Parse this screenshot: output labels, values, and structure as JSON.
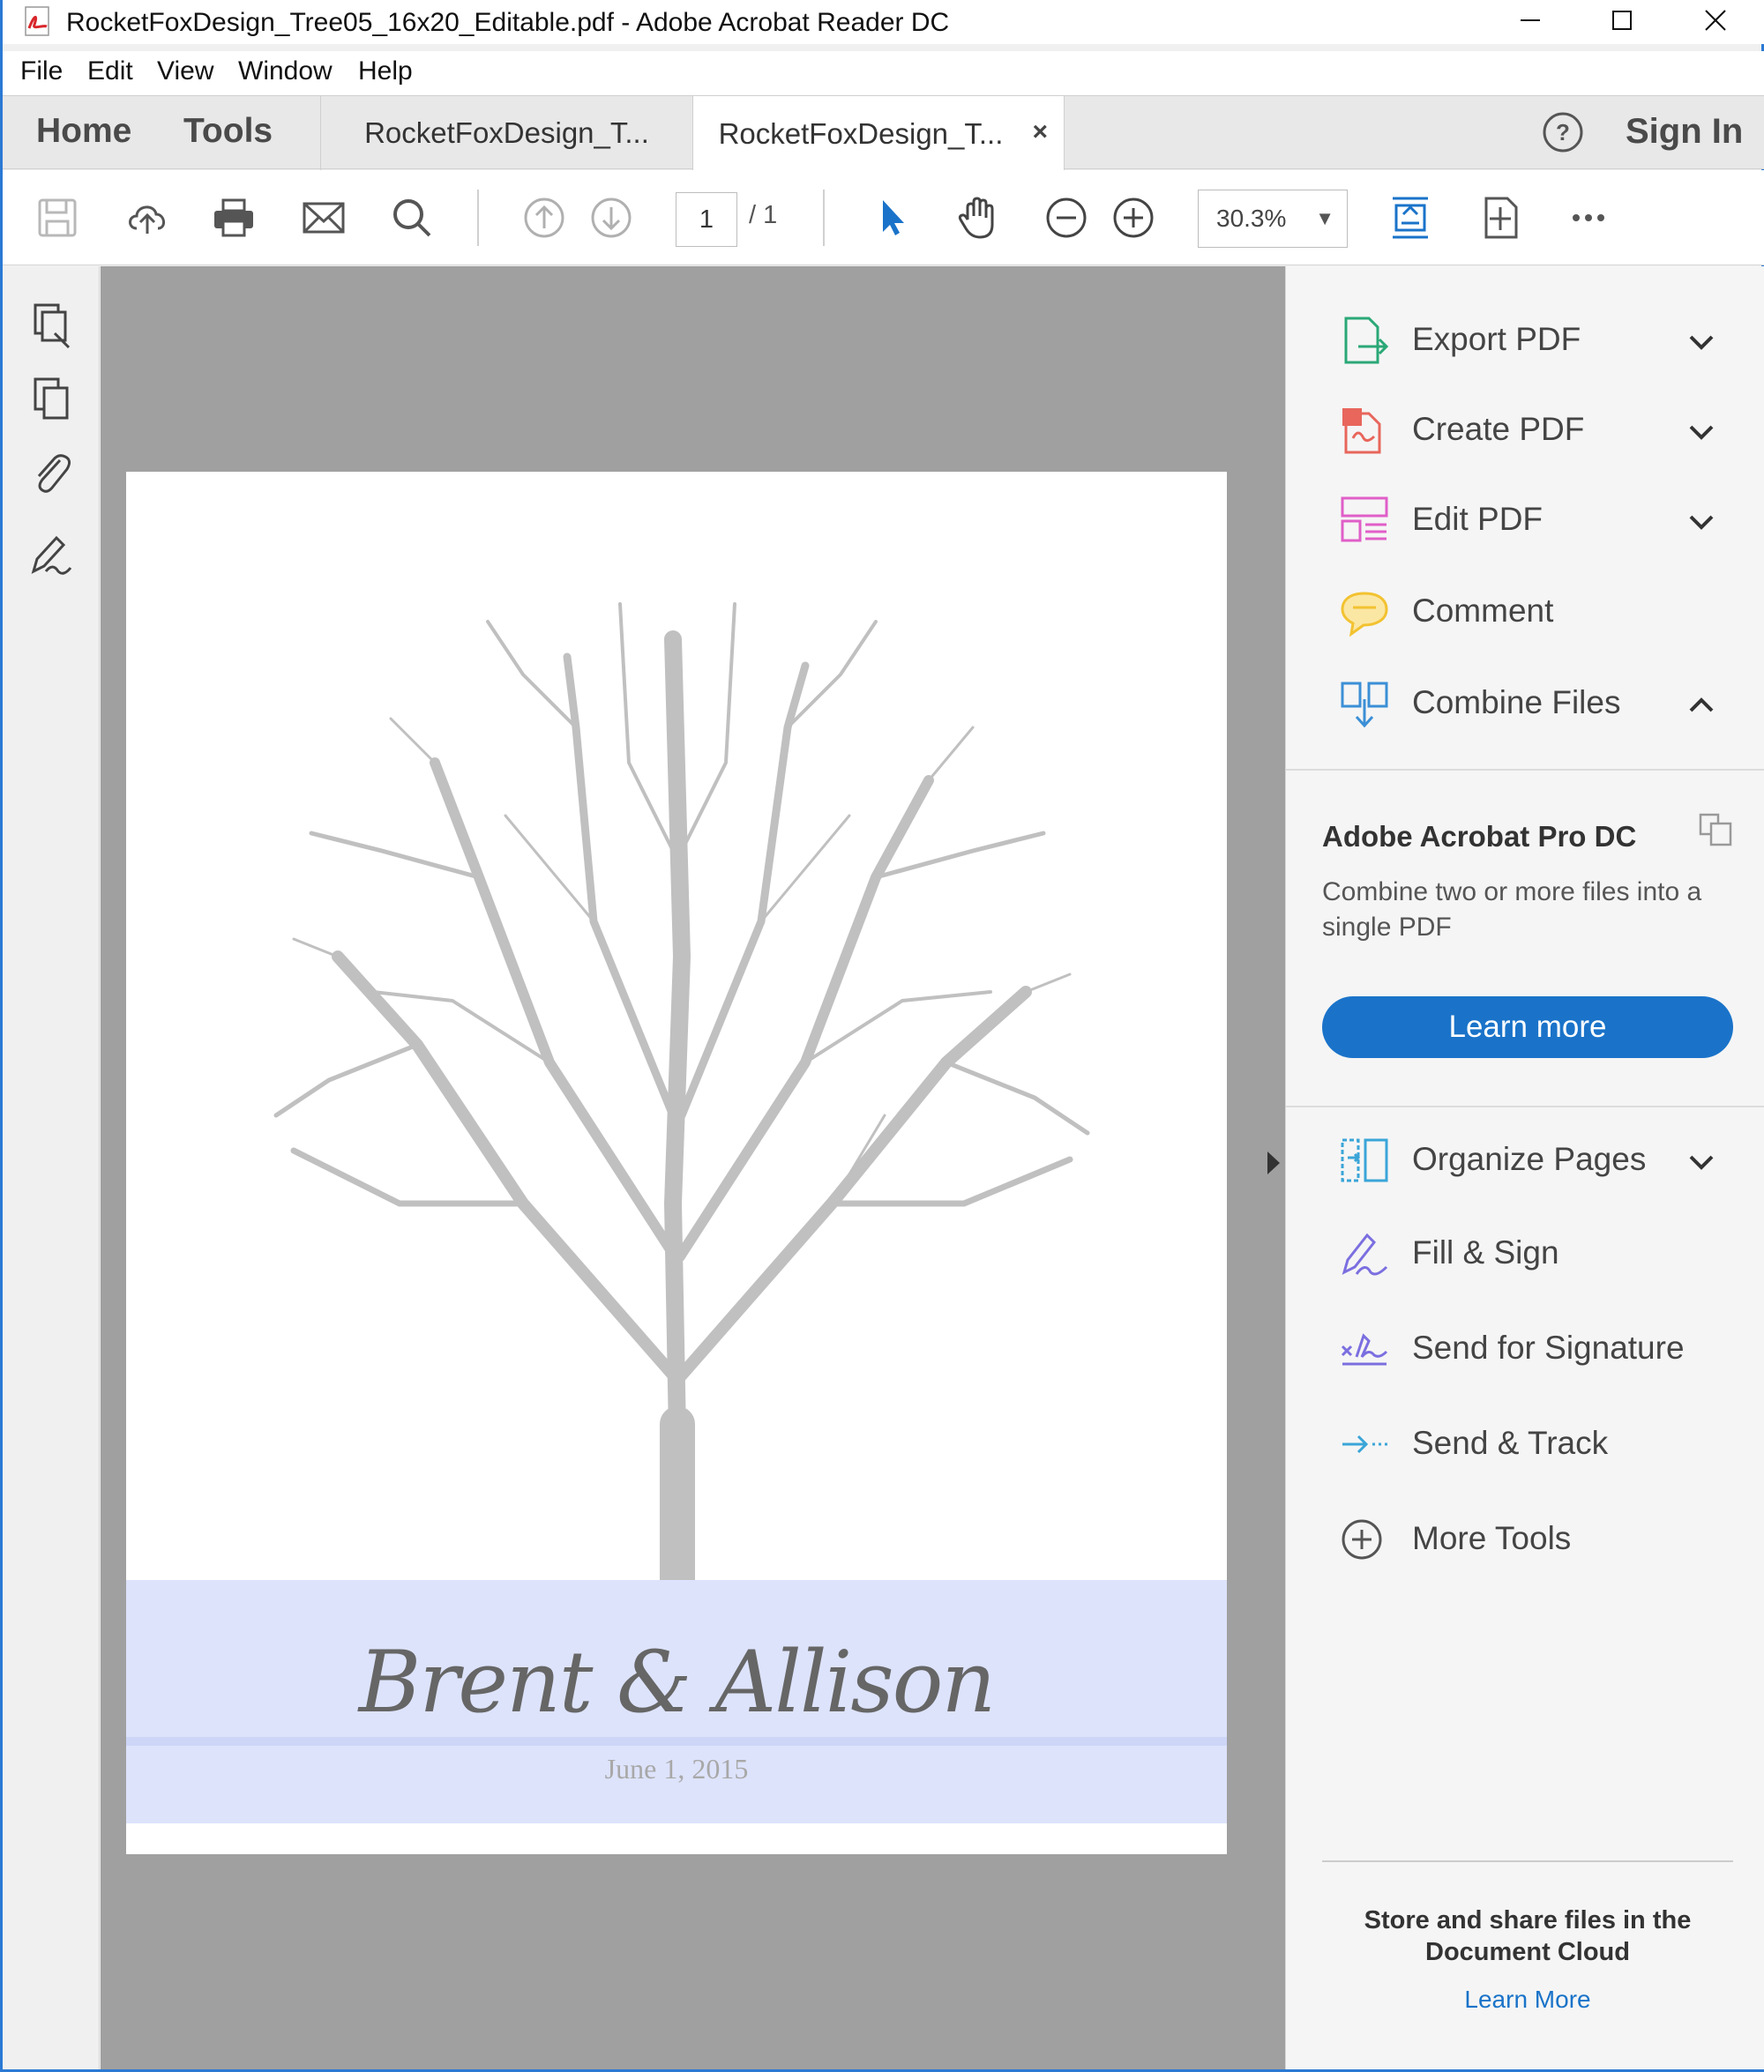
{
  "window": {
    "title": "RocketFoxDesign_Tree05_16x20_Editable.pdf - Adobe Acrobat Reader DC"
  },
  "menu": {
    "items": [
      {
        "label": "File"
      },
      {
        "label": "Edit"
      },
      {
        "label": "View"
      },
      {
        "label": "Window"
      },
      {
        "label": "Help"
      }
    ]
  },
  "tabs": {
    "home": "Home",
    "tools": "Tools",
    "documents": [
      {
        "label": "RocketFoxDesign_T..."
      },
      {
        "label": "RocketFoxDesign_T...",
        "close": "×"
      }
    ],
    "sign_in": "Sign In"
  },
  "toolbar": {
    "page_current": "1",
    "page_total": "/ 1",
    "zoom": "30.3%"
  },
  "document": {
    "names": "Brent & Allison",
    "date": "June 1, 2015"
  },
  "right_pane": {
    "tools_top": [
      {
        "label": "Export PDF",
        "icon": "export-pdf-icon",
        "color": "#2aa876"
      },
      {
        "label": "Create PDF",
        "icon": "create-pdf-icon",
        "color": "#e8665c"
      },
      {
        "label": "Edit PDF",
        "icon": "edit-pdf-icon",
        "color": "#e05ec8"
      },
      {
        "label": "Comment",
        "icon": "comment-icon",
        "color": "#f2c230"
      },
      {
        "label": "Combine Files",
        "icon": "combine-files-icon",
        "color": "#3b8fd6"
      }
    ],
    "promo": {
      "title": "Adobe Acrobat Pro DC",
      "text": "Combine two or more files into a single PDF",
      "button": "Learn more"
    },
    "tools_bottom": [
      {
        "label": "Organize Pages",
        "icon": "organize-pages-icon",
        "color": "#3aa5d8"
      },
      {
        "label": "Fill & Sign",
        "icon": "fill-sign-icon",
        "color": "#7b6fe0"
      },
      {
        "label": "Send for Signature",
        "icon": "send-signature-icon",
        "color": "#7b6fe0"
      },
      {
        "label": "Send & Track",
        "icon": "send-track-icon",
        "color": "#3aa5d8"
      },
      {
        "label": "More Tools",
        "icon": "more-tools-icon",
        "color": "#555555"
      }
    ],
    "cloud": {
      "text": "Store and share files in the Document Cloud",
      "link": "Learn More"
    }
  },
  "colors": {
    "accent": "#1a73c9",
    "select_tool": "#1a73c9",
    "banner": "#dde3fb"
  }
}
